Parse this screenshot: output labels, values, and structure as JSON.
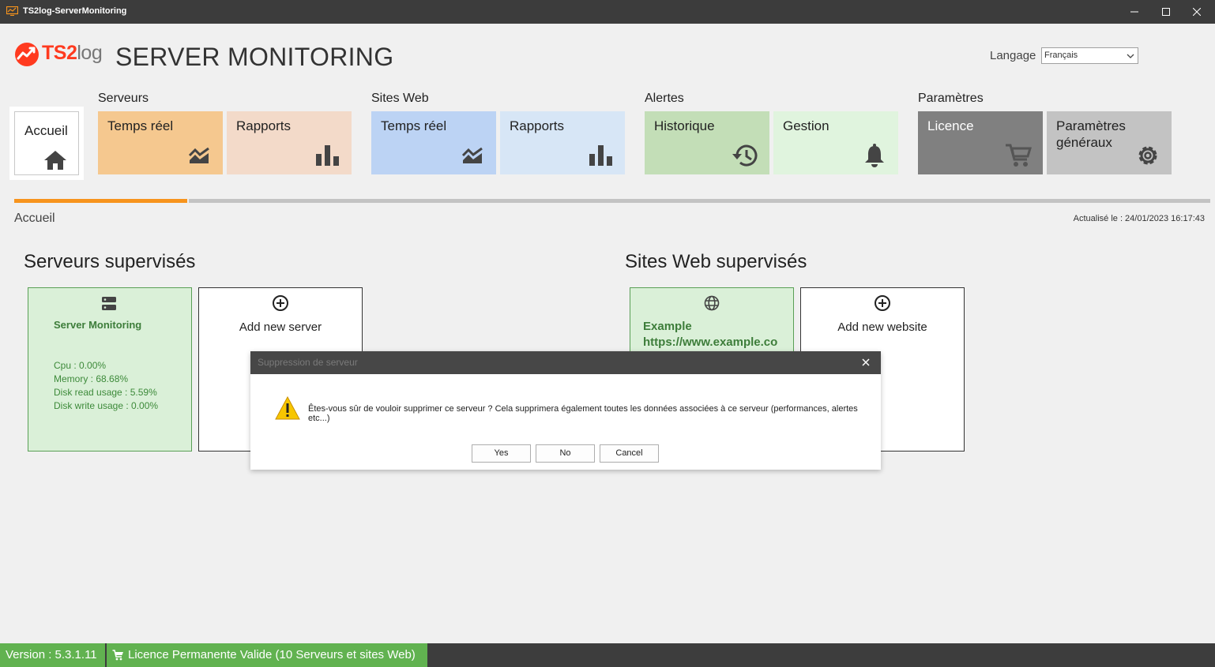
{
  "window": {
    "title": "TS2log-ServerMonitoring",
    "controls": [
      "minimize-icon",
      "maximize-icon",
      "close-icon"
    ]
  },
  "header": {
    "logo_main": "TS2",
    "logo_suffix": "log",
    "app_title": "SERVER MONITORING",
    "language_label": "Langage",
    "language_value": "Français"
  },
  "nav": {
    "home": {
      "label": "Accueil",
      "icon": "home-icon"
    },
    "groups": [
      {
        "label": "Serveurs",
        "tiles": [
          {
            "label": "Temps réel",
            "icon": "realtime-chart-icon",
            "color": "#f5c88f"
          },
          {
            "label": "Rapports",
            "icon": "bar-chart-icon",
            "color": "#f3dac9"
          }
        ]
      },
      {
        "label": "Sites Web",
        "tiles": [
          {
            "label": "Temps réel",
            "icon": "realtime-chart-icon",
            "color": "#bcd3f4"
          },
          {
            "label": "Rapports",
            "icon": "bar-chart-icon",
            "color": "#d7e6f6"
          }
        ]
      },
      {
        "label": "Alertes",
        "tiles": [
          {
            "label": "Historique",
            "icon": "history-icon",
            "color": "#c3deb7"
          },
          {
            "label": "Gestion",
            "icon": "bell-icon",
            "color": "#e0f4de"
          }
        ]
      },
      {
        "label": "Paramètres",
        "tiles": [
          {
            "label": "Licence",
            "icon": "cart-icon",
            "color": "#808080"
          },
          {
            "label_line1": "Paramètres",
            "label_line2": "généraux",
            "icon": "gear-icon",
            "color": "#c3c3c3"
          }
        ]
      }
    ]
  },
  "page": {
    "label": "Accueil",
    "updated": "Actualisé le : 24/01/2023 16:17:43"
  },
  "servers": {
    "title": "Serveurs supervisés",
    "card": {
      "name": "Server Monitoring",
      "cpu": "Cpu : 0.00%",
      "memory": "Memory : 68.68%",
      "disk_read": "Disk read usage : 5.59%",
      "disk_write": "Disk write usage : 0.00%"
    },
    "add_label": "Add new server"
  },
  "websites": {
    "title": "Sites Web supervisés",
    "card": {
      "name": "Example",
      "url": "https://www.example.co"
    },
    "add_label": "Add new website"
  },
  "dialog": {
    "title": "Suppression de serveur",
    "message": "Êtes-vous sûr de vouloir supprimer ce serveur ? Cela supprimera également toutes les données associées à ce serveur (performances, alertes etc...)",
    "yes": "Yes",
    "no": "No",
    "cancel": "Cancel"
  },
  "status": {
    "version": "Version : 5.3.1.11",
    "licence": "Licence Permanente Valide (10 Serveurs et sites Web)"
  }
}
